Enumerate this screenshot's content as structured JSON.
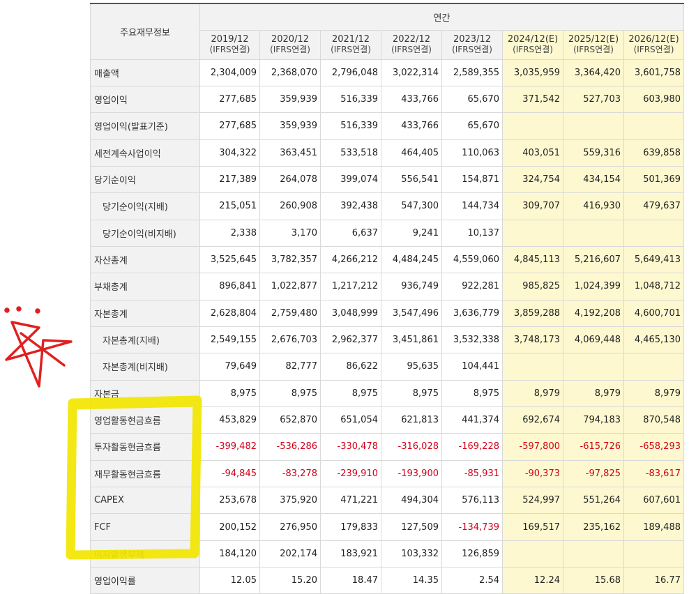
{
  "table": {
    "metric_header": "주요재무정보",
    "section_header": "연간",
    "columns": [
      {
        "year": "2019/12",
        "sub": "(IFRS연결)",
        "est": false
      },
      {
        "year": "2020/12",
        "sub": "(IFRS연결)",
        "est": false
      },
      {
        "year": "2021/12",
        "sub": "(IFRS연결)",
        "est": false
      },
      {
        "year": "2022/12",
        "sub": "(IFRS연결)",
        "est": false
      },
      {
        "year": "2023/12",
        "sub": "(IFRS연결)",
        "est": false
      },
      {
        "year": "2024/12(E)",
        "sub": "(IFRS연결)",
        "est": true
      },
      {
        "year": "2025/12(E)",
        "sub": "(IFRS연결)",
        "est": true
      },
      {
        "year": "2026/12(E)",
        "sub": "(IFRS연결)",
        "est": true
      }
    ],
    "rows": [
      {
        "label": "매출액",
        "indent": false,
        "values": [
          "2,304,009",
          "2,368,070",
          "2,796,048",
          "3,022,314",
          "2,589,355",
          "3,035,959",
          "3,364,420",
          "3,601,758"
        ]
      },
      {
        "label": "영업이익",
        "indent": false,
        "values": [
          "277,685",
          "359,939",
          "516,339",
          "433,766",
          "65,670",
          "371,542",
          "527,703",
          "603,980"
        ]
      },
      {
        "label": "영업이익(발표기준)",
        "indent": false,
        "values": [
          "277,685",
          "359,939",
          "516,339",
          "433,766",
          "65,670",
          "",
          "",
          ""
        ]
      },
      {
        "label": "세전계속사업이익",
        "indent": false,
        "values": [
          "304,322",
          "363,451",
          "533,518",
          "464,405",
          "110,063",
          "403,051",
          "559,316",
          "639,858"
        ]
      },
      {
        "label": "당기순이익",
        "indent": false,
        "values": [
          "217,389",
          "264,078",
          "399,074",
          "556,541",
          "154,871",
          "324,754",
          "434,154",
          "501,369"
        ]
      },
      {
        "label": "당기순이익(지배)",
        "indent": true,
        "values": [
          "215,051",
          "260,908",
          "392,438",
          "547,300",
          "144,734",
          "309,707",
          "416,930",
          "479,637"
        ]
      },
      {
        "label": "당기순이익(비지배)",
        "indent": true,
        "values": [
          "2,338",
          "3,170",
          "6,637",
          "9,241",
          "10,137",
          "",
          "",
          ""
        ]
      },
      {
        "label": "자산총계",
        "indent": false,
        "values": [
          "3,525,645",
          "3,782,357",
          "4,266,212",
          "4,484,245",
          "4,559,060",
          "4,845,113",
          "5,216,607",
          "5,649,413"
        ]
      },
      {
        "label": "부채총계",
        "indent": false,
        "values": [
          "896,841",
          "1,022,877",
          "1,217,212",
          "936,749",
          "922,281",
          "985,825",
          "1,024,399",
          "1,048,712"
        ]
      },
      {
        "label": "자본총계",
        "indent": false,
        "values": [
          "2,628,804",
          "2,759,480",
          "3,048,999",
          "3,547,496",
          "3,636,779",
          "3,859,288",
          "4,192,208",
          "4,600,701"
        ]
      },
      {
        "label": "자본총계(지배)",
        "indent": true,
        "values": [
          "2,549,155",
          "2,676,703",
          "2,962,377",
          "3,451,861",
          "3,532,338",
          "3,748,173",
          "4,069,448",
          "4,465,130"
        ]
      },
      {
        "label": "자본총계(비지배)",
        "indent": true,
        "values": [
          "79,649",
          "82,777",
          "86,622",
          "95,635",
          "104,441",
          "",
          "",
          ""
        ]
      },
      {
        "label": "자본금",
        "indent": false,
        "values": [
          "8,975",
          "8,975",
          "8,975",
          "8,975",
          "8,975",
          "8,979",
          "8,979",
          "8,979"
        ]
      },
      {
        "label": "영업활동현금흐름",
        "indent": false,
        "values": [
          "453,829",
          "652,870",
          "651,054",
          "621,813",
          "441,374",
          "692,674",
          "794,183",
          "870,548"
        ]
      },
      {
        "label": "투자활동현금흐름",
        "indent": false,
        "values": [
          "-399,482",
          "-536,286",
          "-330,478",
          "-316,028",
          "-169,228",
          "-597,800",
          "-615,726",
          "-658,293"
        ]
      },
      {
        "label": "재무활동현금흐름",
        "indent": false,
        "values": [
          "-94,845",
          "-83,278",
          "-239,910",
          "-193,900",
          "-85,931",
          "-90,373",
          "-97,825",
          "-83,617"
        ]
      },
      {
        "label": "CAPEX",
        "indent": false,
        "values": [
          "253,678",
          "375,920",
          "471,221",
          "494,304",
          "576,113",
          "524,997",
          "551,264",
          "607,601"
        ]
      },
      {
        "label": "FCF",
        "indent": false,
        "values": [
          "200,152",
          "276,950",
          "179,833",
          "127,509",
          "-134,739",
          "169,517",
          "235,162",
          "189,488"
        ]
      },
      {
        "label": "이자발생부채",
        "indent": false,
        "values": [
          "184,120",
          "202,174",
          "183,921",
          "103,332",
          "126,859",
          "",
          "",
          ""
        ]
      },
      {
        "label": "영업이익률",
        "indent": false,
        "values": [
          "12.05",
          "15.20",
          "18.47",
          "14.35",
          "2.54",
          "12.24",
          "15.68",
          "16.77"
        ]
      }
    ]
  },
  "colors": {
    "estimate_bg": "#fdf8cf",
    "negative_text": "#d0021b",
    "highlighter": "#f2e600",
    "star_ink": "#e02020"
  }
}
